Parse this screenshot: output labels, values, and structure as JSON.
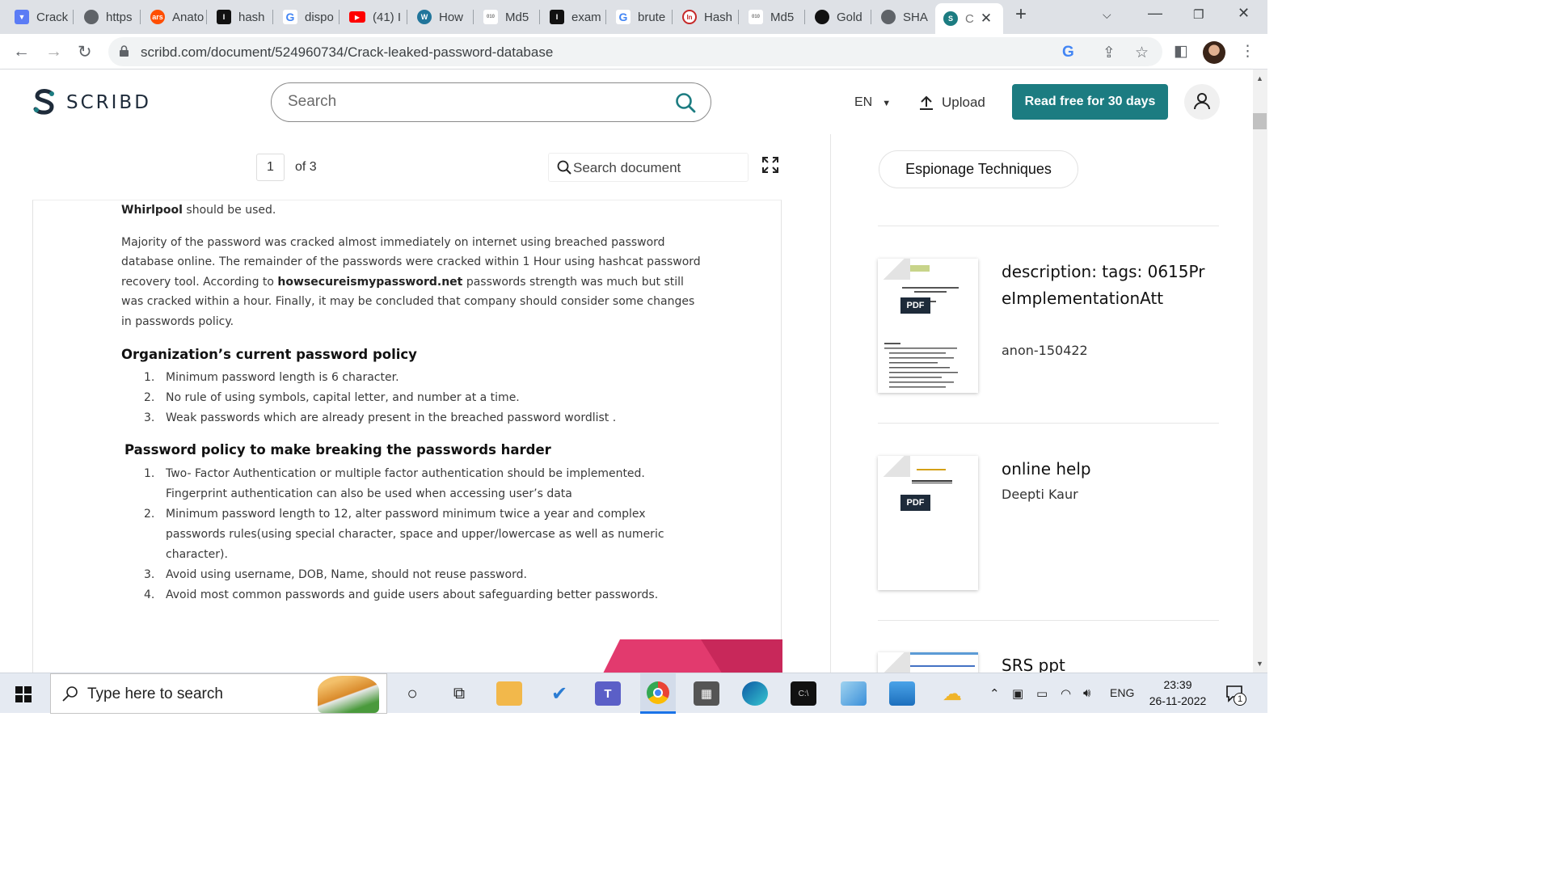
{
  "browser": {
    "tabs": [
      {
        "label": "Crack",
        "icon": "shield-icon",
        "color": "#5b7cf5"
      },
      {
        "label": "https",
        "icon": "globe-icon",
        "color": "#5f6368"
      },
      {
        "label": "Anato",
        "icon": "ars-icon",
        "color": "#ff4e00"
      },
      {
        "label": "hash",
        "icon": "itext-icon",
        "color": "#111111"
      },
      {
        "label": "dispo",
        "icon": "google-icon",
        "color": "#4285f4"
      },
      {
        "label": "(41) I",
        "icon": "youtube-icon",
        "color": "#ff0000"
      },
      {
        "label": "How",
        "icon": "wordpress-icon",
        "color": "#21759b"
      },
      {
        "label": "Md5",
        "icon": "binary-icon",
        "color": "#777777"
      },
      {
        "label": "exam",
        "icon": "itext-icon",
        "color": "#111111"
      },
      {
        "label": "brute",
        "icon": "google-icon",
        "color": "#4285f4"
      },
      {
        "label": "Hash",
        "icon": "in-icon",
        "color": "#c62828"
      },
      {
        "label": "Md5",
        "icon": "binary-icon",
        "color": "#777777"
      },
      {
        "label": "Gold",
        "icon": "github-icon",
        "color": "#111111"
      },
      {
        "label": "SHA",
        "icon": "globe-icon",
        "color": "#5f6368"
      },
      {
        "label": "C",
        "icon": "scribd-icon",
        "color": "#1c7c81"
      }
    ],
    "new_tab": "+",
    "url": "scribd.com/document/524960734/Crack-leaked-password-database"
  },
  "header": {
    "logo": "SCRIBD",
    "search_placeholder": "Search",
    "language": "EN",
    "upload_label": "Upload",
    "cta_label": "Read free for 30 days",
    "brand_color": "#1c7c81"
  },
  "viewer": {
    "current_page": "1",
    "of_pages": "of 3",
    "doc_search_placeholder": "Search document"
  },
  "document": {
    "p1_bold": "Whirlpool",
    "p1_rest": " should be used.",
    "p2_a": "Majority of the password was cracked almost immediately on internet using breached password database online. The remainder of the passwords were cracked within 1 Hour using hashcat password recovery tool. According  to ",
    "p2_bold": "howsecureismypassword.net",
    "p2_b": " passwords strength was much but still was cracked within a hour. Finally, it may be concluded that  company should consider some changes in passwords policy.",
    "h1": "Organization’s current password policy",
    "list1": [
      {
        "num": "1.",
        "text": "Minimum password length is 6 character."
      },
      {
        "num": "2.",
        "text": "No rule of using symbols, capital letter, and number at a time."
      },
      {
        "num": "3.",
        "text": "Weak passwords which are already present in the breached password wordlist ."
      }
    ],
    "h2": "Password policy to make breaking the passwords harder",
    "list2": [
      {
        "num": "1.",
        "text": "Two- Factor Authentication or multiple factor authentication should be implemented. Fingerprint authentication can also be used when accessing user’s data"
      },
      {
        "num": "2.",
        "text": "Minimum password length to 12, alter password minimum twice a year and complex passwords rules(using special character, space and upper/lowercase as well as numeric character)."
      },
      {
        "num": "3.",
        "text": "Avoid using  username, DOB, Name, should not reuse password."
      },
      {
        "num": "4.",
        "text": "Avoid most common passwords and guide users about safeguarding better passwords."
      }
    ]
  },
  "sidebar": {
    "chip": "Espionage Techniques",
    "items": [
      {
        "title": "description: tags: 0615PreImplementationAtt",
        "author": "anon-150422",
        "badge": "PDF"
      },
      {
        "title": "online help",
        "author": "Deepti Kaur",
        "badge": "PDF"
      },
      {
        "title": "SRS  ppt",
        "author": "",
        "badge": ""
      }
    ]
  },
  "taskbar": {
    "search_placeholder": "Type here to search",
    "language": "ENG",
    "time": "23:39",
    "date": "26-11-2022",
    "notification_count": "1"
  }
}
